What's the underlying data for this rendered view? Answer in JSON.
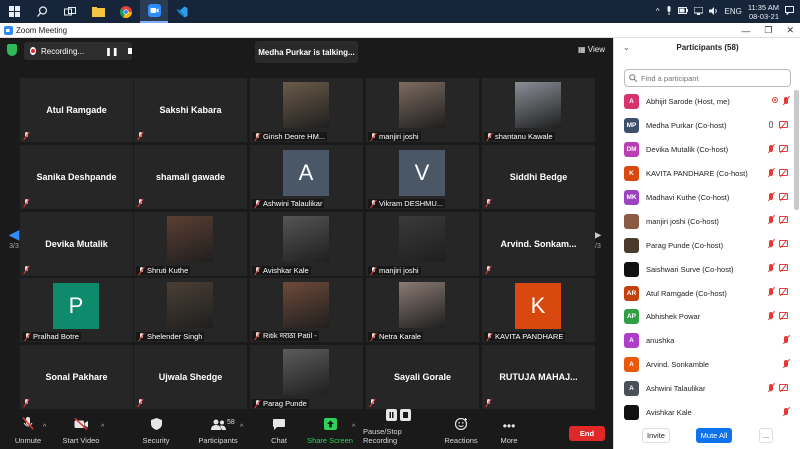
{
  "taskbar": {
    "lang": "ENG",
    "time": "11:35 AM",
    "date": "08-03-21"
  },
  "window": {
    "title": "Zoom Meeting"
  },
  "meeting": {
    "recording_label": "Recording...",
    "talking": "Medha Purkar is talking...",
    "view_label": "View",
    "page_indicator": "3/3"
  },
  "tiles": [
    {
      "name": "Atul Ramgade",
      "type": "name"
    },
    {
      "name": "Sakshi Kabara",
      "type": "name"
    },
    {
      "name": "Girish Deore HM...",
      "type": "photo"
    },
    {
      "name": "manjiri joshi",
      "type": "photo"
    },
    {
      "name": "shantanu Kawale",
      "type": "photo"
    },
    {
      "name": "Sanika Deshpande",
      "type": "name"
    },
    {
      "name": "shamali gawade",
      "type": "name"
    },
    {
      "name": "Ashwini Talaulikar",
      "letter": "A",
      "type": "letter"
    },
    {
      "name": "Vikram DESHMU...",
      "letter": "V",
      "type": "letter"
    },
    {
      "name": "Siddhi Bedge",
      "type": "name"
    },
    {
      "name": "Devika Mutalik",
      "type": "name"
    },
    {
      "name": "Shruti Kuthe",
      "type": "photo"
    },
    {
      "name": "Avishkar Kale",
      "type": "photo"
    },
    {
      "name": "manjiri joshi",
      "type": "photo"
    },
    {
      "name": "Arvind.  Sonkam...",
      "type": "name"
    },
    {
      "name": "Pralhad Botre",
      "letter": "P",
      "type": "letter"
    },
    {
      "name": "Shelender Singh",
      "type": "photo"
    },
    {
      "name": "Ritik मराठा Patil -",
      "type": "photo"
    },
    {
      "name": "Netra Karale",
      "type": "photo"
    },
    {
      "name": "KAVITA PANDHARE",
      "letter": "K",
      "type": "letter"
    },
    {
      "name": "Sonal Pakhare",
      "type": "name"
    },
    {
      "name": "Ujwala Shedge",
      "type": "name"
    },
    {
      "name": "Parag Punde",
      "type": "photo"
    },
    {
      "name": "Sayali Gorale",
      "type": "name"
    },
    {
      "name": "RUTUJA MAHAJ...",
      "type": "name"
    }
  ],
  "toolbar": {
    "unmute": "Unmute",
    "start_video": "Start Video",
    "security": "Security",
    "participants": "Participants",
    "participants_count": "58",
    "chat": "Chat",
    "share_screen": "Share Screen",
    "pause_recording": "Pause/Stop Recording",
    "reactions": "Reactions",
    "more": "More",
    "end": "End"
  },
  "panel": {
    "title": "Participants (58)",
    "search_placeholder": "Find a participant",
    "invite": "Invite",
    "mute_all": "Mute All",
    "more": "...",
    "participants": [
      {
        "initials": "A",
        "name": "Abhijit Sarode (Host, me)",
        "color": "#d6336c"
      },
      {
        "initials": "MP",
        "name": "Medha Purkar (Co-host)",
        "color": "#3d4f6b"
      },
      {
        "initials": "DM",
        "name": "Devika Mutalik (Co-host)",
        "color": "#b93fb3"
      },
      {
        "initials": "K",
        "name": "KAVITA PANDHARE (Co-host)",
        "color": "#d9480f"
      },
      {
        "initials": "MK",
        "name": "Madhavi Kuthe (Co-host)",
        "color": "#9c44c0"
      },
      {
        "initials": "",
        "name": "manjiri joshi (Co-host)",
        "color": "#8a5a44"
      },
      {
        "initials": "",
        "name": "Parag Punde (Co-host)",
        "color": "#4a3b2d"
      },
      {
        "initials": "",
        "name": "Saishwari Surve (Co-host)",
        "color": "#111111"
      },
      {
        "initials": "AR",
        "name": "Atul Ramgade (Co-host)",
        "color": "#c2410c"
      },
      {
        "initials": "AP",
        "name": "Abhishek Powar",
        "color": "#2f9e44"
      },
      {
        "initials": "A",
        "name": "anushka",
        "color": "#ae3ec9"
      },
      {
        "initials": "A",
        "name": "Arvind. Sonkamble",
        "color": "#e8590c"
      },
      {
        "initials": "A",
        "name": "Ashwini Talaulikar",
        "color": "#495057"
      },
      {
        "initials": "",
        "name": "Avishkar Kale",
        "color": "#111111"
      }
    ]
  }
}
